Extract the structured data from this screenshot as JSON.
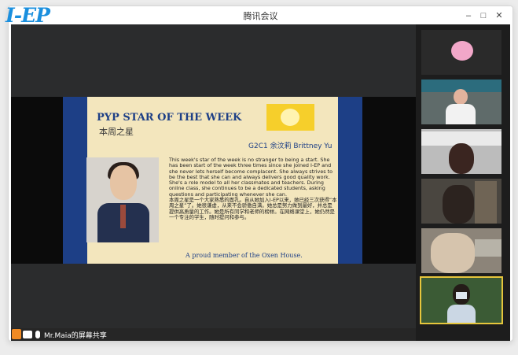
{
  "app": {
    "logo_text": "I-EP",
    "window_title": "腾讯会议"
  },
  "window_controls": {
    "minimize": "–",
    "maximize": "□",
    "close": "✕"
  },
  "share_status": {
    "label": "Mr.Maia的屏幕共享"
  },
  "slide": {
    "title": "PYP STAR OF THE WEEK",
    "subtitle": "本周之星",
    "student": "G2C1 余汶莉 Brittney Yu",
    "paragraph_en": "This week's star of the week is no stranger to being a start. She has been start of the week three times since she joined I-EP and she never lets herself become complacent. She always strives to be the best that she can and always delivers good quality work. She's a role model to all her classmates and teachers. During online class, she continues to be a dedicated students, asking questions and participating whenever she can.",
    "paragraph_zh": "本周之星是一个大家熟悉的面孔。自从她加入I-EP以来，她已经三次获得“本周之星”了。她很谦虚，从来不会骄傲自满。她总是努力做到最好，并总是提供高质量的工作。她是所有同学和老师的榜样。在网络课堂上，她仍然是一个专注的学生，随时提问和参与。",
    "footer": "A proud member of the Oxen House."
  },
  "colors": {
    "accent": "#1a8fde",
    "slide_navy": "#1d3f86",
    "badge_yellow": "#f6cf2b",
    "slide_bg": "#f3e6bd"
  },
  "participants": [
    "participant-1",
    "participant-2",
    "participant-3",
    "participant-4",
    "participant-5",
    "participant-6"
  ]
}
